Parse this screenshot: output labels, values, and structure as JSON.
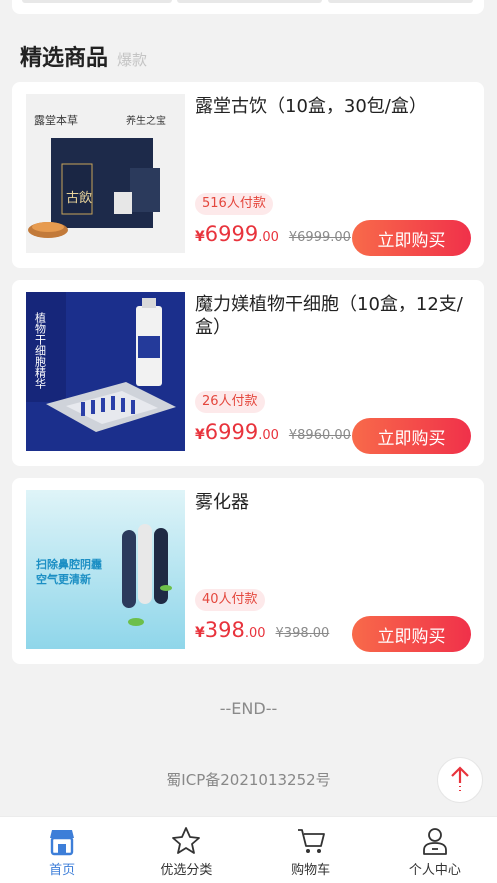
{
  "section": {
    "title": "精选商品",
    "subtitle": "爆款"
  },
  "products": [
    {
      "title": "露堂古饮（10盒，30包/盒）",
      "sold": "516人付款",
      "currency": "¥",
      "price_int": "6999",
      "price_dec": ".00",
      "original_price": "¥6999.00",
      "buy_label": "立即购买",
      "image_text": [
        "露堂本草",
        "养生之宝",
        "古飲"
      ]
    },
    {
      "title": "魔力媄植物干细胞（10盒，12支/盒）",
      "sold": "26人付款",
      "currency": "¥",
      "price_int": "6999",
      "price_dec": ".00",
      "original_price": "¥8960.00",
      "buy_label": "立即购买",
      "image_text": [
        "植物干细胞精华"
      ]
    },
    {
      "title": "雾化器",
      "sold": "40人付款",
      "currency": "¥",
      "price_int": "398",
      "price_dec": ".00",
      "original_price": "¥398.00",
      "buy_label": "立即购买",
      "image_text": [
        "扫除鼻腔阴霾",
        "空气更清新"
      ]
    }
  ],
  "end_text": "--END--",
  "icp": "蜀ICP备2021013252号",
  "tabs": [
    {
      "label": "首页",
      "icon": "shop-icon",
      "active": true
    },
    {
      "label": "优选分类",
      "icon": "star-icon",
      "active": false
    },
    {
      "label": "购物车",
      "icon": "cart-icon",
      "active": false
    },
    {
      "label": "个人中心",
      "icon": "user-icon",
      "active": false
    }
  ],
  "colors": {
    "accent_red": "#e8333c",
    "active_tab_blue": "#3d7ed8",
    "badge_bg": "#fde9ea"
  }
}
